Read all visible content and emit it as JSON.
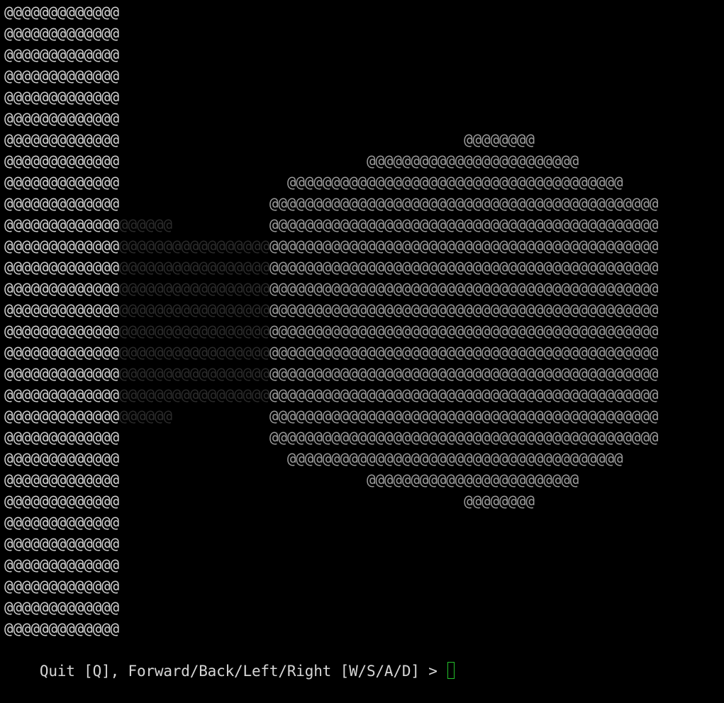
{
  "terminal": {
    "colors": {
      "background": "#000000",
      "bright": "#cfcfcf",
      "mid": "#9a9a9a",
      "dim": "#2b2b2b",
      "prompt_text": "#d6d6d6",
      "cursor": "#23c02b"
    },
    "frame_rows": [
      [
        {
          "tone": "bright",
          "text": "@@@@@@@@@@@@@"
        }
      ],
      [
        {
          "tone": "bright",
          "text": "@@@@@@@@@@@@@"
        }
      ],
      [
        {
          "tone": "bright",
          "text": "@@@@@@@@@@@@@"
        }
      ],
      [
        {
          "tone": "bright",
          "text": "@@@@@@@@@@@@@"
        }
      ],
      [
        {
          "tone": "bright",
          "text": "@@@@@@@@@@@@@"
        }
      ],
      [
        {
          "tone": "bright",
          "text": "@@@@@@@@@@@@@"
        }
      ],
      [
        {
          "tone": "bright",
          "text": "@@@@@@@@@@@@@"
        },
        {
          "tone": "none",
          "text": "                                       "
        },
        {
          "tone": "mid",
          "text": "@@@@@@@@"
        }
      ],
      [
        {
          "tone": "bright",
          "text": "@@@@@@@@@@@@@"
        },
        {
          "tone": "none",
          "text": "                            "
        },
        {
          "tone": "mid",
          "text": "@@@@@@@@@@@@@@@@@@@@@@@@"
        }
      ],
      [
        {
          "tone": "bright",
          "text": "@@@@@@@@@@@@@"
        },
        {
          "tone": "none",
          "text": "                   "
        },
        {
          "tone": "mid",
          "text": "@@@@@@@@@@@@@@@@@@@@@@@@@@@@@@@@@@@@@@"
        }
      ],
      [
        {
          "tone": "bright",
          "text": "@@@@@@@@@@@@@"
        },
        {
          "tone": "none",
          "text": "                 "
        },
        {
          "tone": "mid",
          "text": "@@@@@@@@@@@@@@@@@@@@@@@@@@@@@@@@@@@@@@@@@@@@"
        }
      ],
      [
        {
          "tone": "bright",
          "text": "@@@@@@@@@@@@@"
        },
        {
          "tone": "dim",
          "text": "@@@@@@"
        },
        {
          "tone": "none",
          "text": "           "
        },
        {
          "tone": "mid",
          "text": "@@@@@@@@@@@@@@@@@@@@@@@@@@@@@@@@@@@@@@@@@@@@"
        }
      ],
      [
        {
          "tone": "bright",
          "text": "@@@@@@@@@@@@@"
        },
        {
          "tone": "dim",
          "text": "@@@@@@@@@@@@@@@@@"
        },
        {
          "tone": "mid",
          "text": "@@@@@@@@@@@@@@@@@@@@@@@@@@@@@@@@@@@@@@@@@@@@"
        }
      ],
      [
        {
          "tone": "bright",
          "text": "@@@@@@@@@@@@@"
        },
        {
          "tone": "dim",
          "text": "@@@@@@@@@@@@@@@@@"
        },
        {
          "tone": "mid",
          "text": "@@@@@@@@@@@@@@@@@@@@@@@@@@@@@@@@@@@@@@@@@@@@"
        }
      ],
      [
        {
          "tone": "bright",
          "text": "@@@@@@@@@@@@@"
        },
        {
          "tone": "dim",
          "text": "@@@@@@@@@@@@@@@@@"
        },
        {
          "tone": "mid",
          "text": "@@@@@@@@@@@@@@@@@@@@@@@@@@@@@@@@@@@@@@@@@@@@"
        }
      ],
      [
        {
          "tone": "bright",
          "text": "@@@@@@@@@@@@@"
        },
        {
          "tone": "dim",
          "text": "@@@@@@@@@@@@@@@@@"
        },
        {
          "tone": "mid",
          "text": "@@@@@@@@@@@@@@@@@@@@@@@@@@@@@@@@@@@@@@@@@@@@"
        }
      ],
      [
        {
          "tone": "bright",
          "text": "@@@@@@@@@@@@@"
        },
        {
          "tone": "dim",
          "text": "@@@@@@@@@@@@@@@@@"
        },
        {
          "tone": "mid",
          "text": "@@@@@@@@@@@@@@@@@@@@@@@@@@@@@@@@@@@@@@@@@@@@"
        }
      ],
      [
        {
          "tone": "bright",
          "text": "@@@@@@@@@@@@@"
        },
        {
          "tone": "dim",
          "text": "@@@@@@@@@@@@@@@@@"
        },
        {
          "tone": "mid",
          "text": "@@@@@@@@@@@@@@@@@@@@@@@@@@@@@@@@@@@@@@@@@@@@"
        }
      ],
      [
        {
          "tone": "bright",
          "text": "@@@@@@@@@@@@@"
        },
        {
          "tone": "dim",
          "text": "@@@@@@@@@@@@@@@@@"
        },
        {
          "tone": "mid",
          "text": "@@@@@@@@@@@@@@@@@@@@@@@@@@@@@@@@@@@@@@@@@@@@"
        }
      ],
      [
        {
          "tone": "bright",
          "text": "@@@@@@@@@@@@@"
        },
        {
          "tone": "dim",
          "text": "@@@@@@@@@@@@@@@@@"
        },
        {
          "tone": "mid",
          "text": "@@@@@@@@@@@@@@@@@@@@@@@@@@@@@@@@@@@@@@@@@@@@"
        }
      ],
      [
        {
          "tone": "bright",
          "text": "@@@@@@@@@@@@@"
        },
        {
          "tone": "dim",
          "text": "@@@@@@"
        },
        {
          "tone": "none",
          "text": "           "
        },
        {
          "tone": "mid",
          "text": "@@@@@@@@@@@@@@@@@@@@@@@@@@@@@@@@@@@@@@@@@@@@"
        }
      ],
      [
        {
          "tone": "bright",
          "text": "@@@@@@@@@@@@@"
        },
        {
          "tone": "none",
          "text": "                 "
        },
        {
          "tone": "mid",
          "text": "@@@@@@@@@@@@@@@@@@@@@@@@@@@@@@@@@@@@@@@@@@@@"
        }
      ],
      [
        {
          "tone": "bright",
          "text": "@@@@@@@@@@@@@"
        },
        {
          "tone": "none",
          "text": "                   "
        },
        {
          "tone": "mid",
          "text": "@@@@@@@@@@@@@@@@@@@@@@@@@@@@@@@@@@@@@@"
        }
      ],
      [
        {
          "tone": "bright",
          "text": "@@@@@@@@@@@@@"
        },
        {
          "tone": "none",
          "text": "                            "
        },
        {
          "tone": "mid",
          "text": "@@@@@@@@@@@@@@@@@@@@@@@@"
        }
      ],
      [
        {
          "tone": "bright",
          "text": "@@@@@@@@@@@@@"
        },
        {
          "tone": "none",
          "text": "                                       "
        },
        {
          "tone": "mid",
          "text": "@@@@@@@@"
        }
      ],
      [
        {
          "tone": "bright",
          "text": "@@@@@@@@@@@@@"
        }
      ],
      [
        {
          "tone": "bright",
          "text": "@@@@@@@@@@@@@"
        }
      ],
      [
        {
          "tone": "bright",
          "text": "@@@@@@@@@@@@@"
        }
      ],
      [
        {
          "tone": "bright",
          "text": "@@@@@@@@@@@@@"
        }
      ],
      [
        {
          "tone": "bright",
          "text": "@@@@@@@@@@@@@"
        }
      ],
      [
        {
          "tone": "bright",
          "text": "@@@@@@@@@@@@@"
        }
      ]
    ],
    "prompt": {
      "text": "Quit [Q], Forward/Back/Left/Right [W/S/A/D] > "
    }
  }
}
